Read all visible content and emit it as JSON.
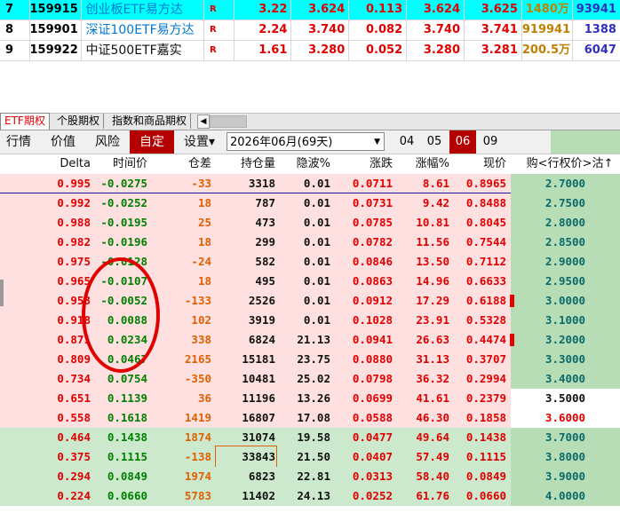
{
  "quote_table": {
    "rows": [
      {
        "idx": "7",
        "code": "159915",
        "name": "创业板ETF易方达",
        "flag": "R",
        "price": "3.22",
        "last": "3.624",
        "change": "0.113",
        "bid": "3.624",
        "ask": "3.625",
        "volume": "1480万",
        "amount": "93941",
        "selected": true,
        "name_color": "blue"
      },
      {
        "idx": "8",
        "code": "159901",
        "name": "深证100ETF易方达",
        "flag": "R",
        "price": "2.24",
        "last": "3.740",
        "change": "0.082",
        "bid": "3.740",
        "ask": "3.741",
        "volume": "919941",
        "amount": "1388",
        "selected": false,
        "name_color": "blue"
      },
      {
        "idx": "9",
        "code": "159922",
        "name": "中证500ETF嘉实",
        "flag": "R",
        "price": "1.61",
        "last": "3.280",
        "change": "0.052",
        "bid": "3.280",
        "ask": "3.281",
        "volume": "200.5万",
        "amount": "6047",
        "selected": false,
        "name_color": "black"
      }
    ]
  },
  "tabs": {
    "etf": "ETF期权",
    "stock": "个股期权",
    "index": "指数和商品期权",
    "scroll_left_icon": "◀"
  },
  "toolbar": {
    "quote": "行情",
    "price": "价值",
    "risk": "风险",
    "custom": "自定",
    "settings": "设置▾",
    "month_select": "2026年06月(69天)",
    "month_select_arrow": "▼",
    "months": [
      "04",
      "05",
      "06",
      "09"
    ]
  },
  "columns": {
    "delta": "Delta",
    "time_value": "时间价",
    "spread": "仓差",
    "open_interest": "持仓量",
    "iv": "隐波%",
    "change": "涨跌",
    "change_pct": "涨幅%",
    "price": "现价",
    "strike": "购<行权价>沽↑"
  },
  "rows": [
    {
      "delta": "0.995",
      "tv": "-0.0275",
      "spread": "-33",
      "oi": "3318",
      "iv": "0.01",
      "chg": "0.0711",
      "pct": "8.61",
      "px": "0.8965",
      "strike": "2.7000",
      "zone": "pink",
      "strike_style": "green",
      "first": true
    },
    {
      "delta": "0.992",
      "tv": "-0.0252",
      "spread": "18",
      "oi": "787",
      "iv": "0.01",
      "chg": "0.0731",
      "pct": "9.42",
      "px": "0.8488",
      "strike": "2.7500",
      "zone": "pink",
      "strike_style": "green"
    },
    {
      "delta": "0.988",
      "tv": "-0.0195",
      "spread": "25",
      "oi": "473",
      "iv": "0.01",
      "chg": "0.0785",
      "pct": "10.81",
      "px": "0.8045",
      "strike": "2.8000",
      "zone": "pink",
      "strike_style": "green"
    },
    {
      "delta": "0.982",
      "tv": "-0.0196",
      "spread": "18",
      "oi": "299",
      "iv": "0.01",
      "chg": "0.0782",
      "pct": "11.56",
      "px": "0.7544",
      "strike": "2.8500",
      "zone": "pink",
      "strike_style": "green"
    },
    {
      "delta": "0.975",
      "tv": "-0.0128",
      "spread": "-24",
      "oi": "582",
      "iv": "0.01",
      "chg": "0.0846",
      "pct": "13.50",
      "px": "0.7112",
      "strike": "2.9000",
      "zone": "pink",
      "strike_style": "green"
    },
    {
      "delta": "0.965",
      "tv": "-0.0107",
      "spread": "18",
      "oi": "495",
      "iv": "0.01",
      "chg": "0.0863",
      "pct": "14.96",
      "px": "0.6633",
      "strike": "2.9500",
      "zone": "pink",
      "strike_style": "green"
    },
    {
      "delta": "0.953",
      "tv": "-0.0052",
      "spread": "-133",
      "oi": "2526",
      "iv": "0.01",
      "chg": "0.0912",
      "pct": "17.29",
      "px": "0.6188",
      "strike": "3.0000",
      "zone": "pink",
      "strike_style": "green",
      "marker": true
    },
    {
      "delta": "0.918",
      "tv": "0.0088",
      "spread": "102",
      "oi": "3919",
      "iv": "0.01",
      "chg": "0.1028",
      "pct": "23.91",
      "px": "0.5328",
      "strike": "3.1000",
      "zone": "pink",
      "strike_style": "green"
    },
    {
      "delta": "0.871",
      "tv": "0.0234",
      "spread": "338",
      "oi": "6824",
      "iv": "21.13",
      "chg": "0.0941",
      "pct": "26.63",
      "px": "0.4474",
      "strike": "3.2000",
      "zone": "pink",
      "strike_style": "green",
      "marker": true
    },
    {
      "delta": "0.809",
      "tv": "0.0467",
      "spread": "2165",
      "oi": "15181",
      "iv": "23.75",
      "chg": "0.0880",
      "pct": "31.13",
      "px": "0.3707",
      "strike": "3.3000",
      "zone": "pink",
      "strike_style": "green"
    },
    {
      "delta": "0.734",
      "tv": "0.0754",
      "spread": "-350",
      "oi": "10481",
      "iv": "25.02",
      "chg": "0.0798",
      "pct": "36.32",
      "px": "0.2994",
      "strike": "3.4000",
      "zone": "pink",
      "strike_style": "green"
    },
    {
      "delta": "0.651",
      "tv": "0.1139",
      "spread": "36",
      "oi": "11196",
      "iv": "13.26",
      "chg": "0.0699",
      "pct": "41.61",
      "px": "0.2379",
      "strike": "3.5000",
      "zone": "pink",
      "strike_style": "white"
    },
    {
      "delta": "0.558",
      "tv": "0.1618",
      "spread": "1419",
      "oi": "16807",
      "iv": "17.08",
      "chg": "0.0588",
      "pct": "46.30",
      "px": "0.1858",
      "strike": "3.6000",
      "zone": "pink",
      "strike_style": "red"
    },
    {
      "delta": "0.464",
      "tv": "0.1438",
      "spread": "1874",
      "oi": "31074",
      "iv": "19.58",
      "chg": "0.0477",
      "pct": "49.64",
      "px": "0.1438",
      "strike": "3.7000",
      "zone": "green",
      "strike_style": "green"
    },
    {
      "delta": "0.375",
      "tv": "0.1115",
      "spread": "-138",
      "oi": "33843",
      "iv": "21.50",
      "chg": "0.0407",
      "pct": "57.49",
      "px": "0.1115",
      "strike": "3.8000",
      "zone": "green",
      "strike_style": "green",
      "oi_boxed": true
    },
    {
      "delta": "0.294",
      "tv": "0.0849",
      "spread": "1974",
      "oi": "6823",
      "iv": "22.81",
      "chg": "0.0313",
      "pct": "58.40",
      "px": "0.0849",
      "strike": "3.9000",
      "zone": "green",
      "strike_style": "green"
    },
    {
      "delta": "0.224",
      "tv": "0.0660",
      "spread": "5783",
      "oi": "11402",
      "iv": "24.13",
      "chg": "0.0252",
      "pct": "61.76",
      "px": "0.0660",
      "strike": "4.0000",
      "zone": "green",
      "strike_style": "green"
    }
  ]
}
